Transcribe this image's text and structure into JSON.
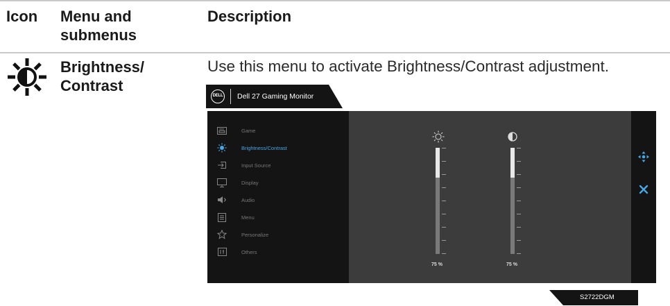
{
  "table": {
    "headers": {
      "icon": "Icon",
      "menu_line1": "Menu and",
      "menu_line2": "submenus",
      "description": "Description"
    },
    "row": {
      "icon_name": "brightness-sun-icon",
      "title_line1": "Brightness/",
      "title_line2": "Contrast",
      "description": "Use this menu to activate Brightness/Contrast adjustment."
    }
  },
  "osd": {
    "logo_text": "DELL",
    "model_title": "Dell 27 Gaming Monitor",
    "menu_items": [
      {
        "label": "Game",
        "icon": "game-icon",
        "active": false
      },
      {
        "label": "Brightness/Contrast",
        "icon": "brightness-icon",
        "active": true
      },
      {
        "label": "Input Source",
        "icon": "input-source-icon",
        "active": false
      },
      {
        "label": "Display",
        "icon": "display-icon",
        "active": false
      },
      {
        "label": "Audio",
        "icon": "audio-icon",
        "active": false
      },
      {
        "label": "Menu",
        "icon": "menu-icon",
        "active": false
      },
      {
        "label": "Personalize",
        "icon": "star-icon",
        "active": false
      },
      {
        "label": "Others",
        "icon": "others-icon",
        "active": false
      }
    ],
    "sliders": [
      {
        "name": "brightness",
        "icon": "sun-icon",
        "value_label": "75 %",
        "level": 0.28
      },
      {
        "name": "contrast",
        "icon": "contrast-icon",
        "value_label": "75 %",
        "level": 0.28
      }
    ],
    "model_tag": "S2722DGM",
    "colors": {
      "accent": "#4aa6e4",
      "menu_bg": "#141414",
      "panel_bg": "#3c3c3c"
    }
  }
}
